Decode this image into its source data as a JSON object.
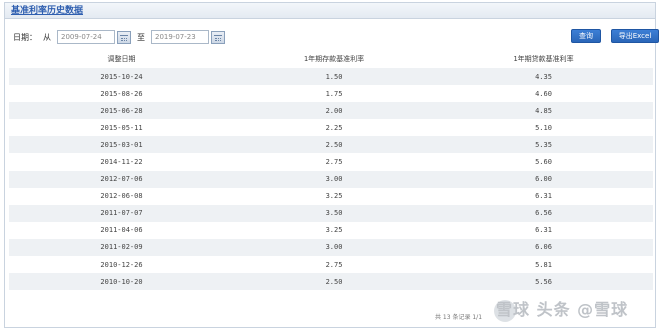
{
  "header": {
    "title": "基准利率历史数据"
  },
  "filter": {
    "date_label": "日期：",
    "from_label": "从",
    "start_date": "2009-07-24",
    "to_label": "至",
    "end_date": "2019-07-23",
    "query_button": "查询",
    "export_button": "导出Excel"
  },
  "table": {
    "columns": [
      "调整日期",
      "1年期存款基准利率",
      "1年期贷款基准利率"
    ],
    "rows": [
      [
        "2015-10-24",
        "1.50",
        "4.35"
      ],
      [
        "2015-08-26",
        "1.75",
        "4.60"
      ],
      [
        "2015-06-28",
        "2.00",
        "4.85"
      ],
      [
        "2015-05-11",
        "2.25",
        "5.10"
      ],
      [
        "2015-03-01",
        "2.50",
        "5.35"
      ],
      [
        "2014-11-22",
        "2.75",
        "5.60"
      ],
      [
        "2012-07-06",
        "3.00",
        "6.00"
      ],
      [
        "2012-06-08",
        "3.25",
        "6.31"
      ],
      [
        "2011-07-07",
        "3.50",
        "6.56"
      ],
      [
        "2011-04-06",
        "3.25",
        "6.31"
      ],
      [
        "2011-02-09",
        "3.00",
        "6.06"
      ],
      [
        "2010-12-26",
        "2.75",
        "5.81"
      ],
      [
        "2010-10-20",
        "2.50",
        "5.56"
      ]
    ]
  },
  "footer": {
    "records": "共 13 条记录 1/1"
  },
  "watermark": {
    "text": "雪球 头条 @雪球"
  }
}
